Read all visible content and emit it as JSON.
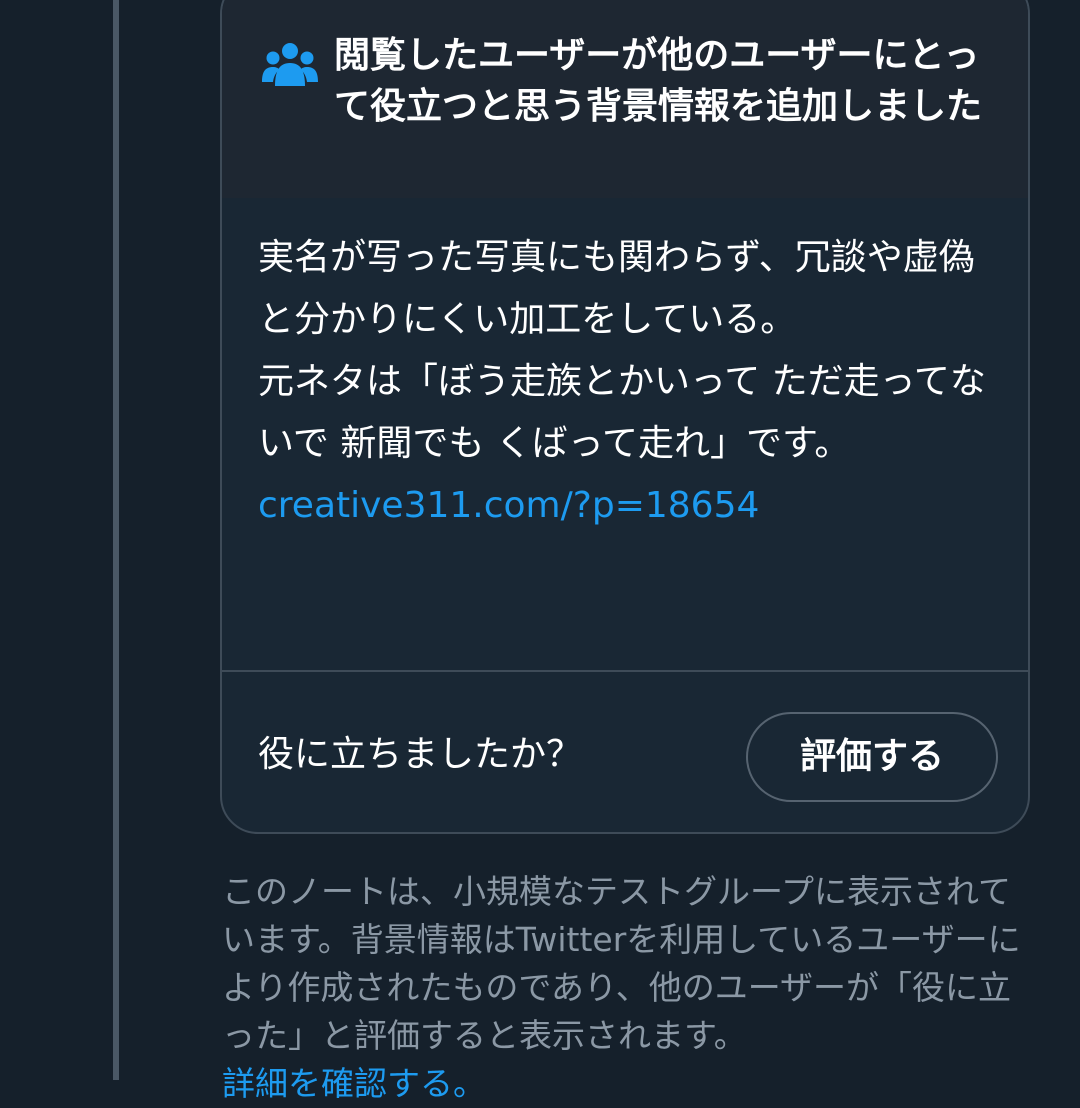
{
  "note": {
    "heading": "閲覧したユーザーが他のユーザーにとって役立つと思う背景情報を追加しました",
    "body_text": "実名が写った写真にも関わらず、冗談や虚偽と分かりにくい加工をしている。\n元ネタは「ぼう走族とかいって ただ走ってないで 新聞でも くばって走れ」です。",
    "link_text": "creative311.com/?p=18654",
    "helpful_question": "役に立ちましたか？",
    "rate_button_label": "評価する"
  },
  "disclaimer": {
    "text": "このノートは、小規模なテストグループに表示されています。背景情報はTwitterを利用しているユーザーにより作成されたものであり、他のユーザーが「役に立った」と評価すると表示されます。",
    "details_link": "詳細を確認する。"
  },
  "icons": {
    "header_icon": "people-icon"
  },
  "colors": {
    "background": "#15202b",
    "card_header": "#1e2732",
    "card_body": "#192734",
    "accent_blue": "#1d9bf0",
    "muted_text": "#8b98a5"
  }
}
